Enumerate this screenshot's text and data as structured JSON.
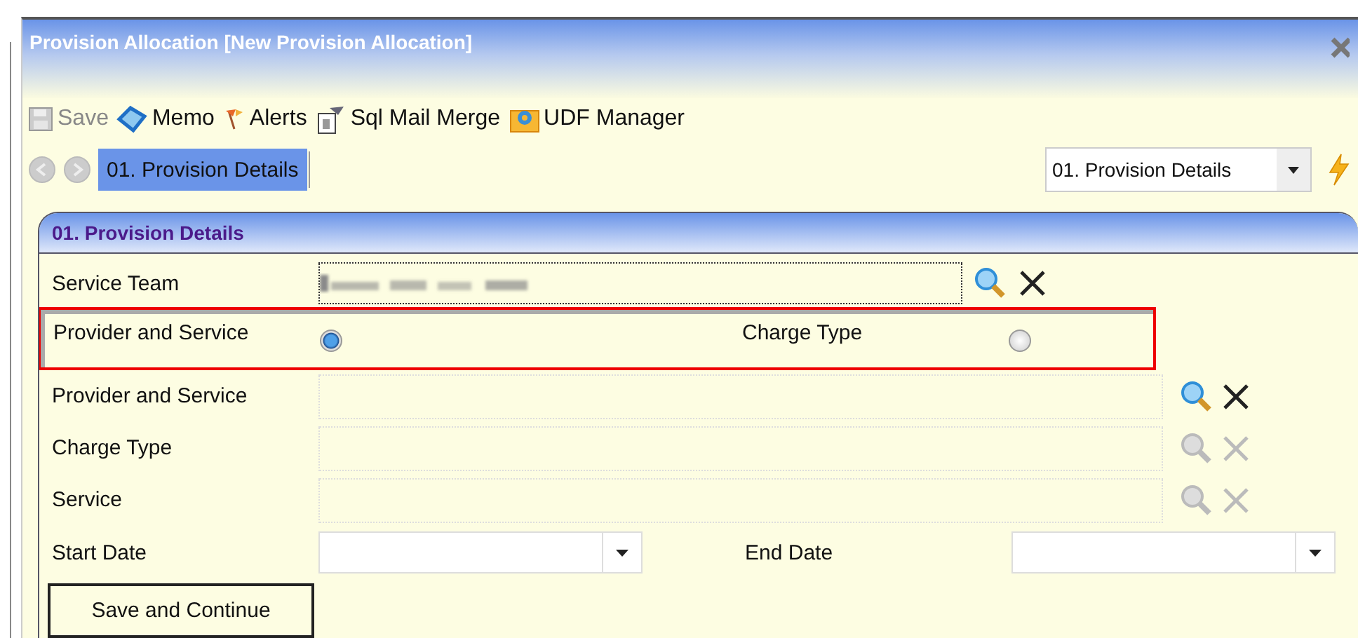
{
  "window": {
    "title": "Provision Allocation [New Provision Allocation]"
  },
  "toolbar": [
    {
      "kind": "save",
      "label": "Save",
      "disabled": true
    },
    {
      "kind": "memo",
      "label": "Memo",
      "disabled": false
    },
    {
      "kind": "alerts",
      "label": "Alerts",
      "disabled": false
    },
    {
      "kind": "mail_merge",
      "label": "Sql Mail Merge",
      "disabled": false
    },
    {
      "kind": "udf",
      "label": "UDF Manager",
      "disabled": false
    }
  ],
  "nav": {
    "tabs": [
      {
        "label": "01. Provision Details",
        "selected": true
      }
    ],
    "page_select": "01. Provision Details"
  },
  "form": {
    "title": "01. Provision Details",
    "service_team": {
      "label": "Service Team"
    },
    "choice": [
      {
        "label": "Provider and Service",
        "selected": true
      },
      {
        "label": "Charge Type",
        "selected": false
      }
    ],
    "lookups": [
      {
        "label": "Provider and Service",
        "disabled": false
      },
      {
        "label": "Charge Type",
        "disabled": true
      },
      {
        "label": "Service",
        "disabled": true
      }
    ],
    "dates": [
      {
        "label": "Start Date"
      },
      {
        "label": "End Date"
      }
    ],
    "button": "Save and Continue"
  }
}
